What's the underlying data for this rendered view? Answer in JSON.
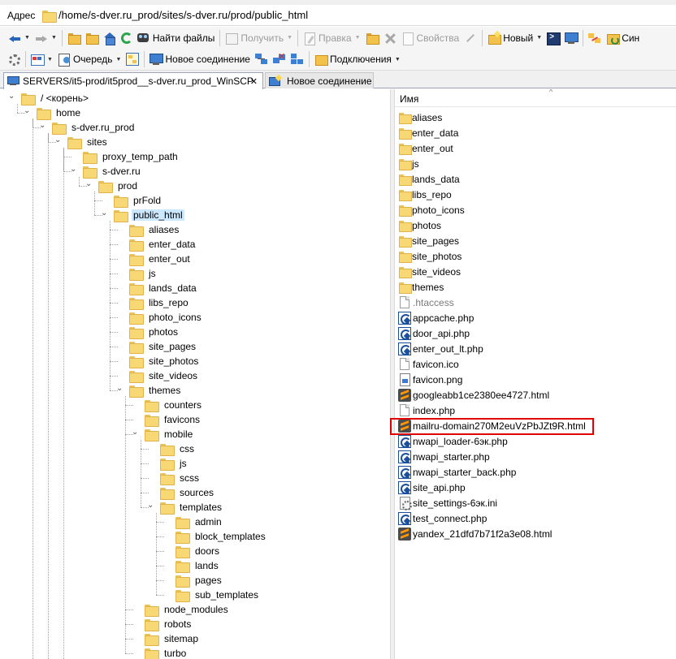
{
  "address": {
    "label": "Адрес",
    "path": "/home/s-dver.ru_prod/sites/s-dver.ru/prod/public_html"
  },
  "toolbar1": {
    "back_icon": "back-arrow-icon",
    "find_files": "Найти файлы",
    "receive": "Получить",
    "edit": "Правка",
    "properties": "Свойства",
    "new": "Новый",
    "sync_cut": "Син"
  },
  "toolbar2": {
    "queue": "Очередь",
    "new_connection": "Новое соединение",
    "connections": "Подключения"
  },
  "tabs": [
    {
      "label": "SERVERS/it5-prod/it5prod__s-dver.ru_prod_WinSCP",
      "close": "✕"
    },
    {
      "label": "Новое соединение"
    }
  ],
  "tree": [
    {
      "label": "/ <корень>"
    },
    {
      "label": "home"
    },
    {
      "label": "s-dver.ru_prod"
    },
    {
      "label": "sites"
    },
    {
      "label": "proxy_temp_path"
    },
    {
      "label": "s-dver.ru"
    },
    {
      "label": "prod"
    },
    {
      "label": "prFold"
    },
    {
      "label": "public_html"
    },
    {
      "label": "aliases"
    },
    {
      "label": "enter_data"
    },
    {
      "label": "enter_out"
    },
    {
      "label": "js"
    },
    {
      "label": "lands_data"
    },
    {
      "label": "libs_repo"
    },
    {
      "label": "photo_icons"
    },
    {
      "label": "photos"
    },
    {
      "label": "site_pages"
    },
    {
      "label": "site_photos"
    },
    {
      "label": "site_videos"
    },
    {
      "label": "themes"
    },
    {
      "label": "counters"
    },
    {
      "label": "favicons"
    },
    {
      "label": "mobile"
    },
    {
      "label": "css"
    },
    {
      "label": "js"
    },
    {
      "label": "scss"
    },
    {
      "label": "sources"
    },
    {
      "label": "templates"
    },
    {
      "label": "admin"
    },
    {
      "label": "block_templates"
    },
    {
      "label": "doors"
    },
    {
      "label": "lands"
    },
    {
      "label": "pages"
    },
    {
      "label": "sub_templates"
    },
    {
      "label": "node_modules"
    },
    {
      "label": "robots"
    },
    {
      "label": "sitemap"
    },
    {
      "label": "turbo"
    }
  ],
  "files": {
    "column_name": "Имя",
    "sort_indicator": "^",
    "items": [
      {
        "name": "aliases",
        "icon": "folder-icon"
      },
      {
        "name": "enter_data",
        "icon": "folder-icon"
      },
      {
        "name": "enter_out",
        "icon": "folder-icon"
      },
      {
        "name": "js",
        "icon": "folder-icon"
      },
      {
        "name": "lands_data",
        "icon": "folder-icon"
      },
      {
        "name": "libs_repo",
        "icon": "folder-icon"
      },
      {
        "name": "photo_icons",
        "icon": "folder-icon"
      },
      {
        "name": "photos",
        "icon": "folder-icon"
      },
      {
        "name": "site_pages",
        "icon": "folder-icon"
      },
      {
        "name": "site_photos",
        "icon": "folder-icon"
      },
      {
        "name": "site_videos",
        "icon": "folder-icon"
      },
      {
        "name": "themes",
        "icon": "folder-icon"
      },
      {
        "name": ".htaccess",
        "icon": "blank-file-icon"
      },
      {
        "name": "appcache.php",
        "icon": "php-file-icon"
      },
      {
        "name": "door_api.php",
        "icon": "php-file-icon"
      },
      {
        "name": "enter_out_lt.php",
        "icon": "php-file-icon"
      },
      {
        "name": "favicon.ico",
        "icon": "blank-file-icon"
      },
      {
        "name": "favicon.png",
        "icon": "image-file-icon"
      },
      {
        "name": "googleabb1ce2380ee4727.html",
        "icon": "sublime-file-icon"
      },
      {
        "name": "index.php",
        "icon": "blank-file-icon"
      },
      {
        "name": "mailru-domain270M2euVzPbJZt9R.html",
        "icon": "sublime-file-icon"
      },
      {
        "name": "nwapi_loader-6эк.php",
        "icon": "php-file-icon"
      },
      {
        "name": "nwapi_starter.php",
        "icon": "php-file-icon"
      },
      {
        "name": "nwapi_starter_back.php",
        "icon": "php-file-icon"
      },
      {
        "name": "site_api.php",
        "icon": "php-file-icon"
      },
      {
        "name": "site_settings-6эк.ini",
        "icon": "ini-file-icon"
      },
      {
        "name": "test_connect.php",
        "icon": "php-file-icon"
      },
      {
        "name": "yandex_21dfd7b71f2a3e08.html",
        "icon": "sublime-file-icon"
      }
    ]
  },
  "colors": {
    "selection": "#cce8ff",
    "highlight_box": "#e00000",
    "folder": "#f8d775"
  }
}
